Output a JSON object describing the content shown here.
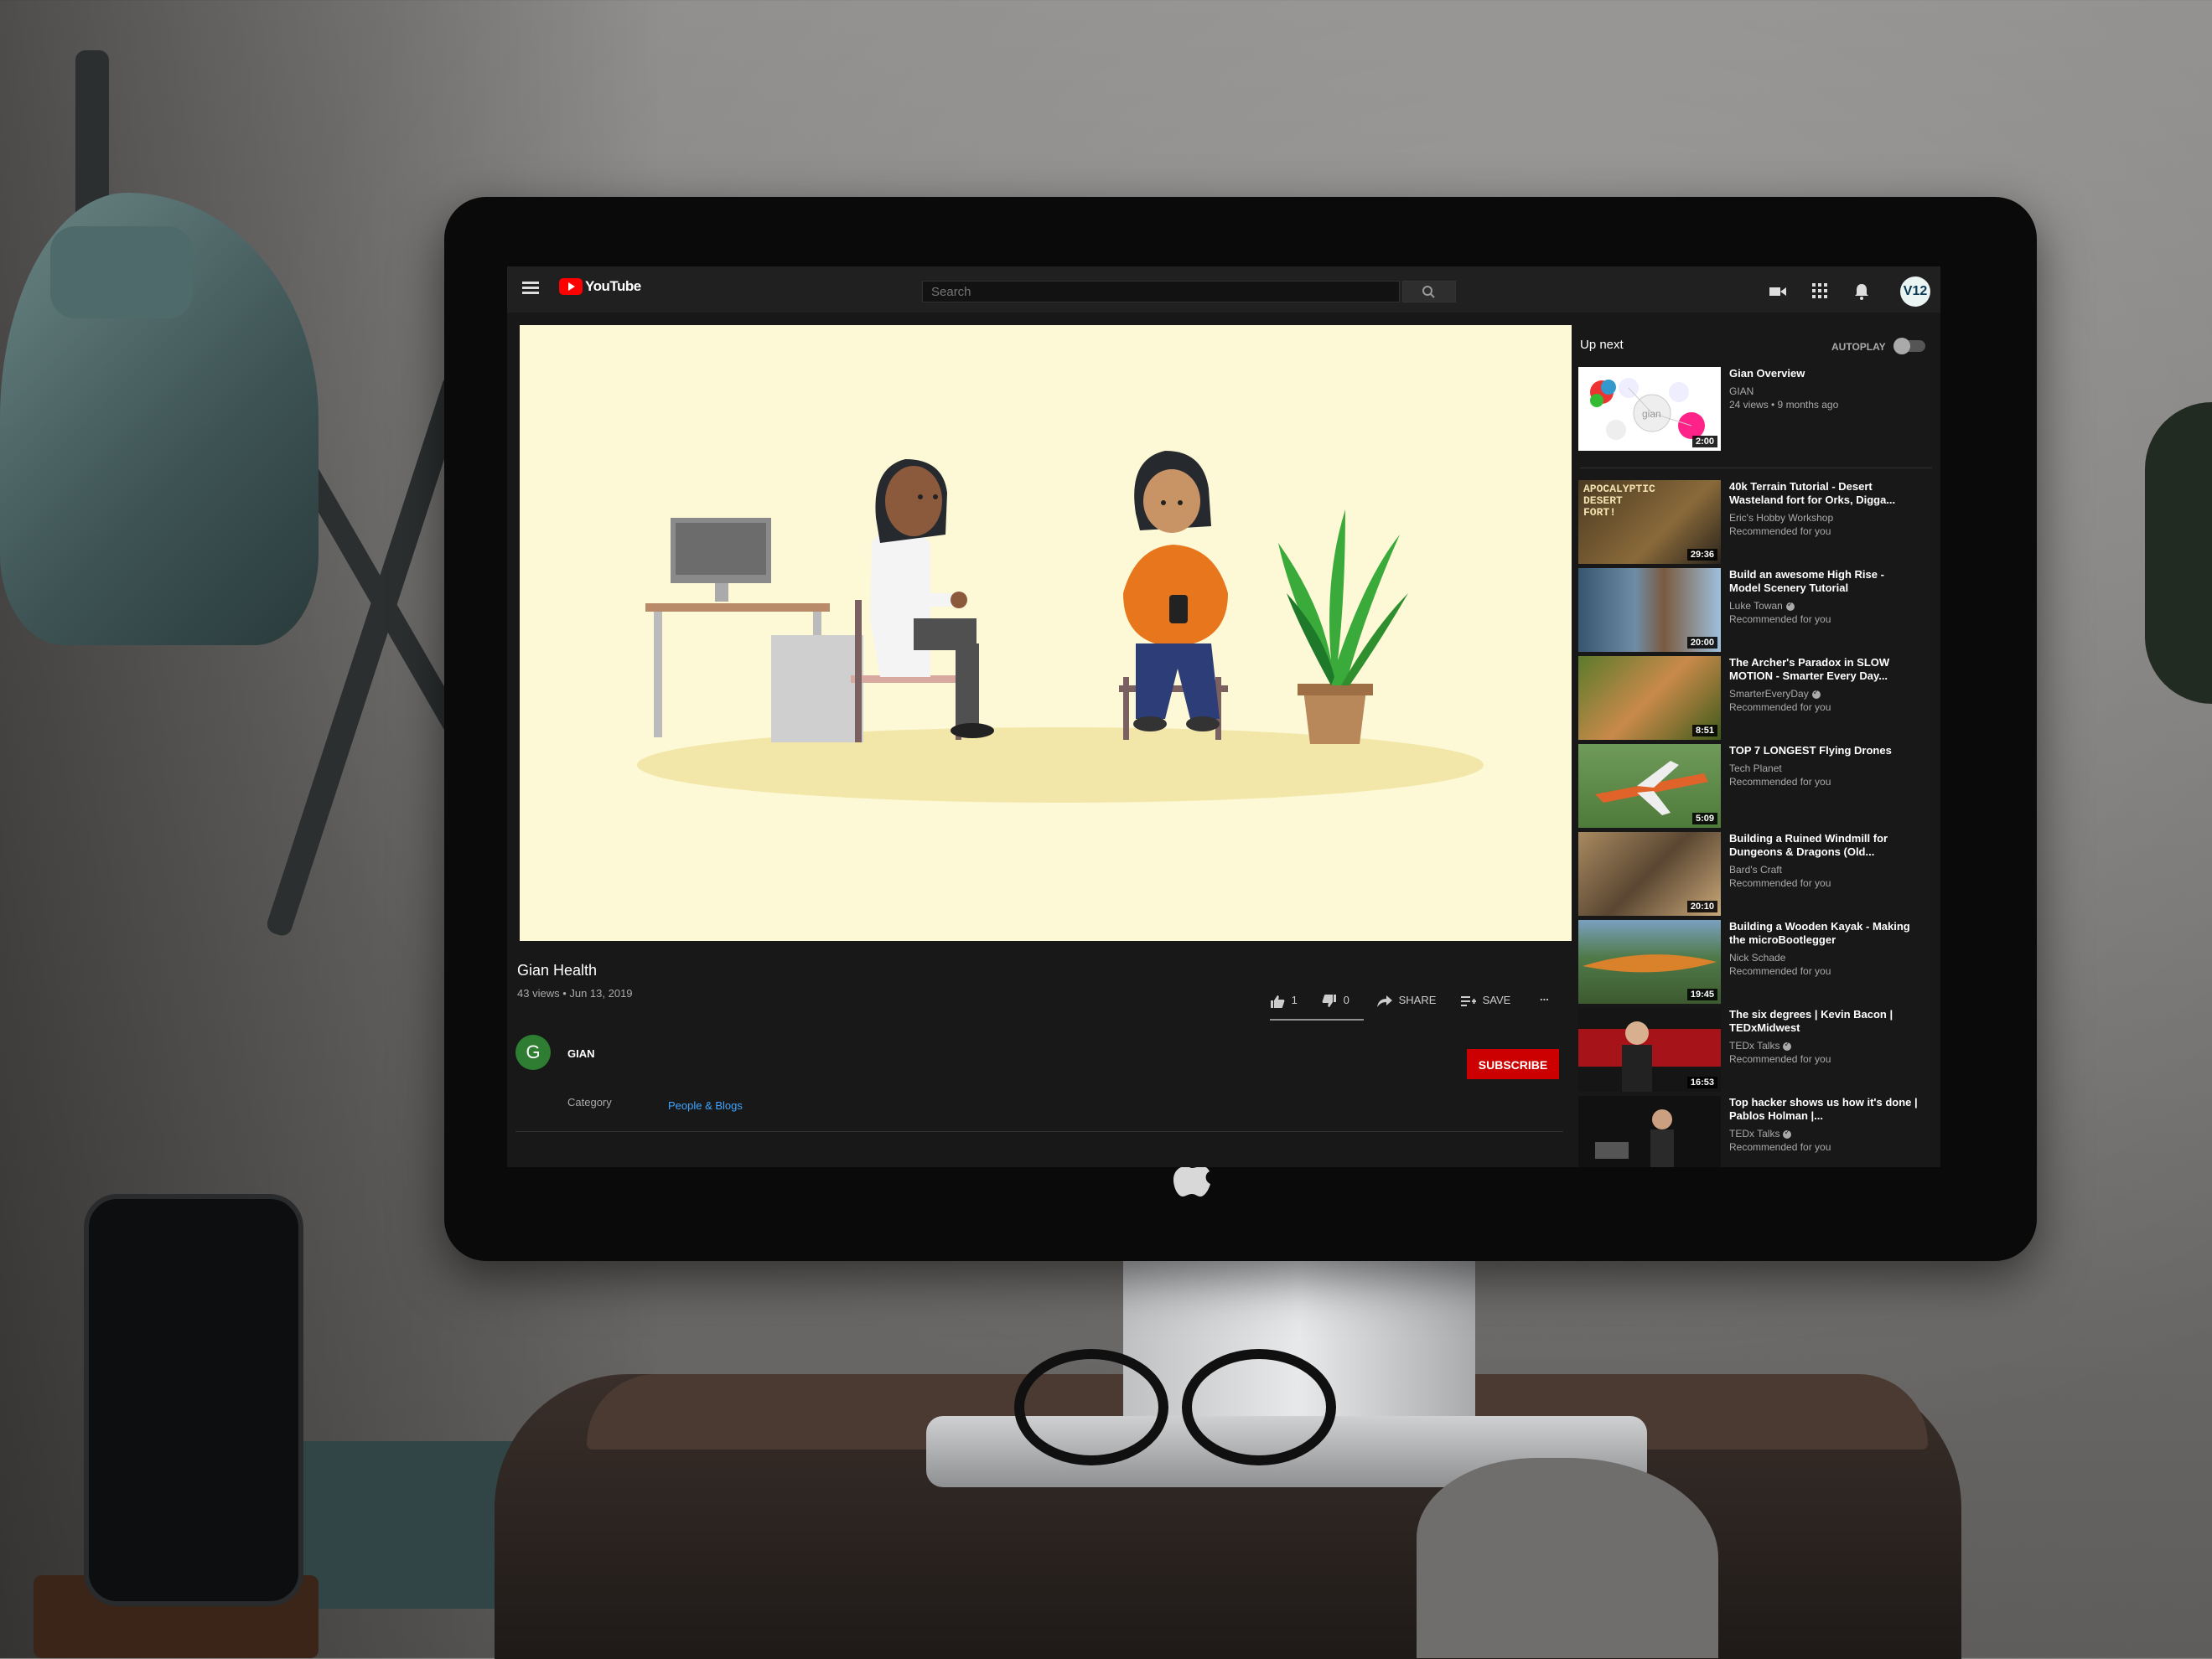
{
  "header": {
    "logo_text": "YouTube",
    "search_placeholder": "Search",
    "avatar_text": "V12"
  },
  "video": {
    "title": "Gian Health",
    "meta": "43 views • Jun 13, 2019",
    "likes": "1",
    "dislikes": "0",
    "share_label": "SHARE",
    "save_label": "SAVE",
    "more_label": "..."
  },
  "channel": {
    "avatar_letter": "G",
    "name": "GIAN",
    "subscribe_label": "SUBSCRIBE",
    "category_label": "Category",
    "category_value": "People & Blogs"
  },
  "sidebar": {
    "up_next_label": "Up next",
    "autoplay_label": "AUTOPLAY",
    "autoplay_on": false,
    "items": [
      {
        "title": "Gian Overview",
        "channel": "GIAN",
        "sub": "24 views • 9 months ago",
        "duration": "2:00",
        "verified": false
      },
      {
        "title": "40k Terrain Tutorial - Desert Wasteland fort for Orks, Digga...",
        "channel": "Eric's Hobby Workshop",
        "sub": "Recommended for you",
        "duration": "29:36",
        "verified": false
      },
      {
        "title": "Build an awesome High Rise - Model Scenery Tutorial",
        "channel": "Luke Towan",
        "sub": "Recommended for you",
        "duration": "20:00",
        "verified": true
      },
      {
        "title": "The Archer's Paradox in SLOW MOTION - Smarter Every Day...",
        "channel": "SmarterEveryDay",
        "sub": "Recommended for you",
        "duration": "8:51",
        "verified": true
      },
      {
        "title": "TOP 7 LONGEST Flying Drones",
        "channel": "Tech Planet",
        "sub": "Recommended for you",
        "duration": "5:09",
        "verified": false
      },
      {
        "title": "Building a Ruined Windmill for Dungeons & Dragons (Old...",
        "channel": "Bard's Craft",
        "sub": "Recommended for you",
        "duration": "20:10",
        "verified": false
      },
      {
        "title": "Building a Wooden Kayak - Making the microBootlegger",
        "channel": "Nick Schade",
        "sub": "Recommended for you",
        "duration": "19:45",
        "verified": false
      },
      {
        "title": "The six degrees | Kevin Bacon | TEDxMidwest",
        "channel": "TEDx Talks",
        "sub": "Recommended for you",
        "duration": "16:53",
        "verified": true
      },
      {
        "title": "Top hacker shows us how it's done | Pablos Holman |...",
        "channel": "TEDx Talks",
        "sub": "Recommended for you",
        "duration": "",
        "verified": true
      }
    ]
  },
  "thumbnail_art": {
    "apocalyptic_text": "APOCALYPTIC DESERT FORT!",
    "gian_text": "gian"
  },
  "colors": {
    "brand_red": "#ff0000",
    "subscribe_red": "#cc0000",
    "link_blue": "#3ea6ff",
    "ui_bg": "#181818",
    "video_bg": "#fdf9d6"
  }
}
